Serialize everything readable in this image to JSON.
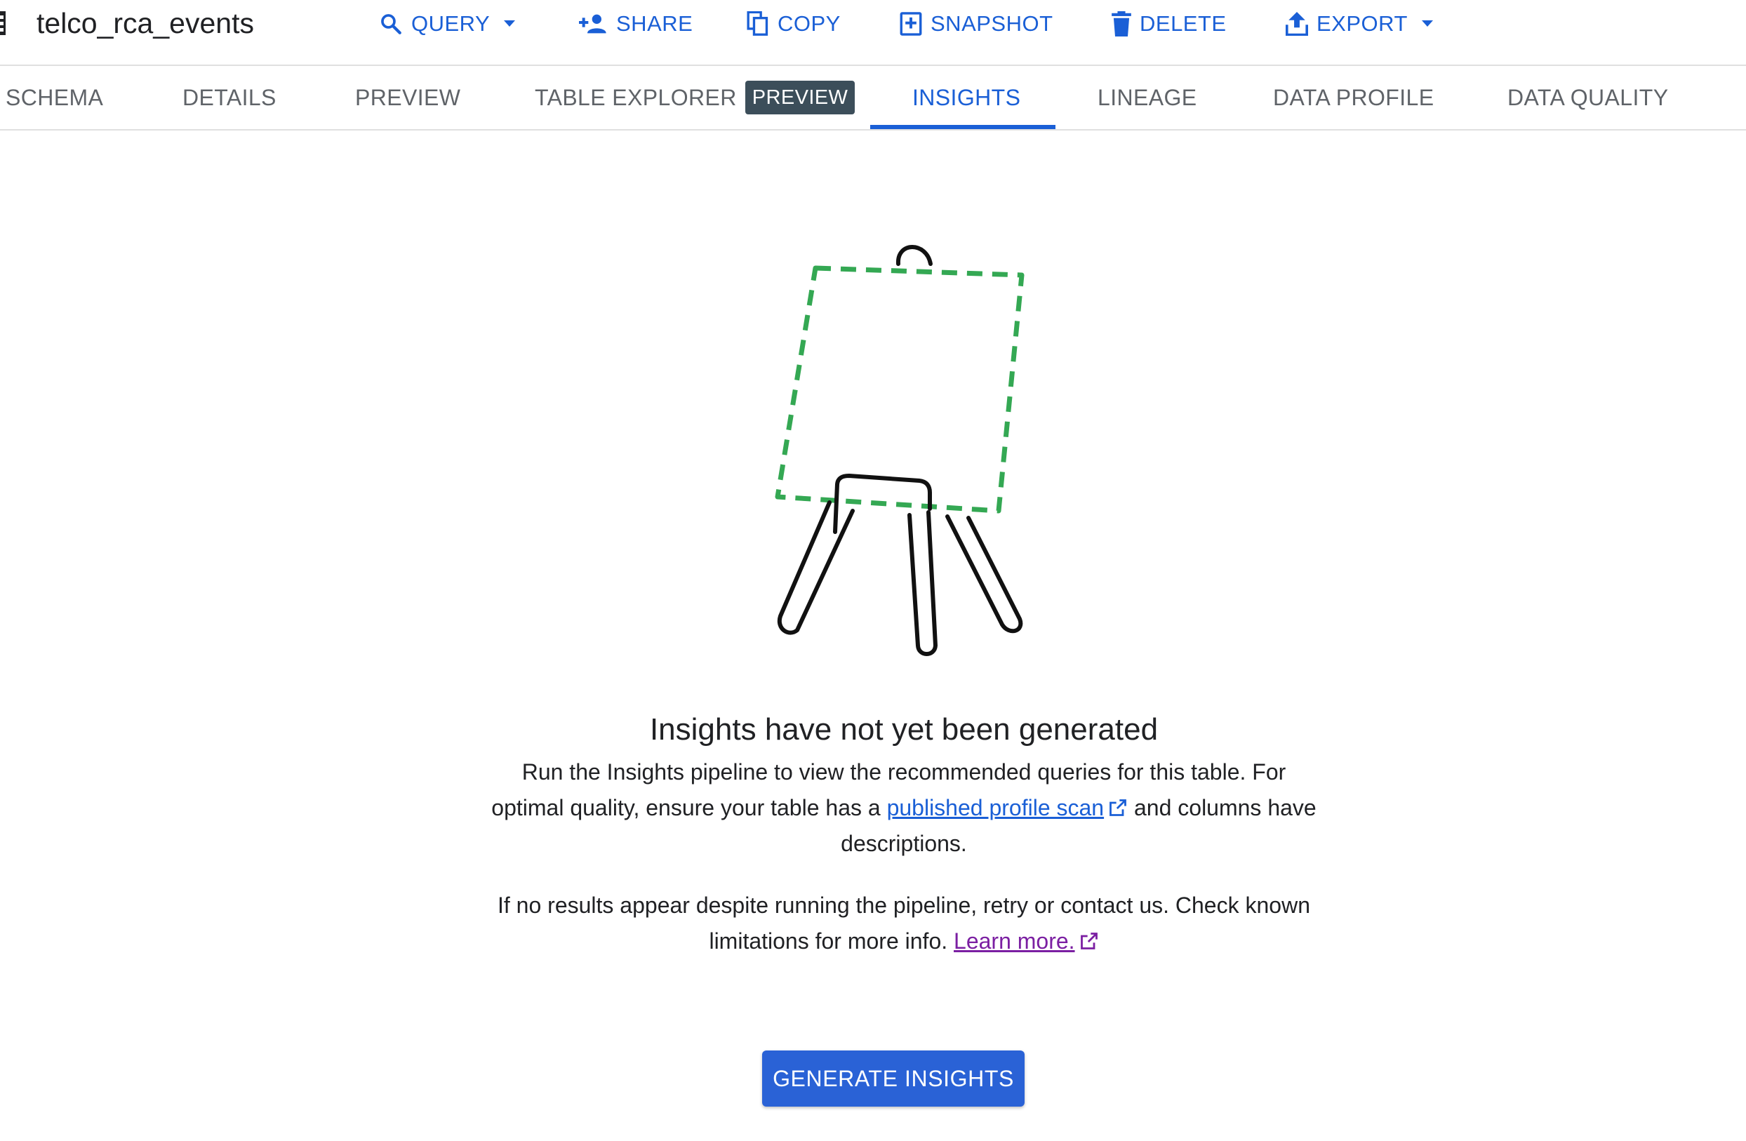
{
  "header": {
    "table_name": "telco_rca_events",
    "actions": {
      "query": "QUERY",
      "share": "SHARE",
      "copy": "COPY",
      "snapshot": "SNAPSHOT",
      "delete": "DELETE",
      "export": "EXPORT"
    }
  },
  "tabs": {
    "schema": "SCHEMA",
    "details": "DETAILS",
    "preview": "PREVIEW",
    "table_explorer": "TABLE EXPLORER",
    "table_explorer_badge": "PREVIEW",
    "insights": "INSIGHTS",
    "lineage": "LINEAGE",
    "data_profile": "DATA PROFILE",
    "data_quality": "DATA QUALITY",
    "active": "INSIGHTS"
  },
  "empty_state": {
    "title": "Insights have not yet been generated",
    "body_before_link": "Run the Insights pipeline to view the recommended queries for this table. For optimal quality, ensure your table has a ",
    "profile_link": "published profile scan",
    "body_after_link": " and columns have descriptions.",
    "help_text": "If no results appear despite running the pipeline, retry or contact us. Check known limitations for more info. ",
    "learn_more_link": "Learn more.",
    "button_label": "GENERATE INSIGHTS"
  },
  "colors": {
    "accent": "#1a5fd6",
    "button": "#2a62d6",
    "visited_link": "#7b1fa2",
    "illustration_dash": "#34a853",
    "badge_bg": "#3c4e5a"
  },
  "icons": {
    "table": "table-icon",
    "query": "search-icon",
    "share": "person-add-icon",
    "copy": "copy-icon",
    "snapshot": "snapshot-icon",
    "delete": "trash-icon",
    "export": "upload-icon",
    "dropdown": "caret-down-icon",
    "external": "open-in-new-icon"
  }
}
